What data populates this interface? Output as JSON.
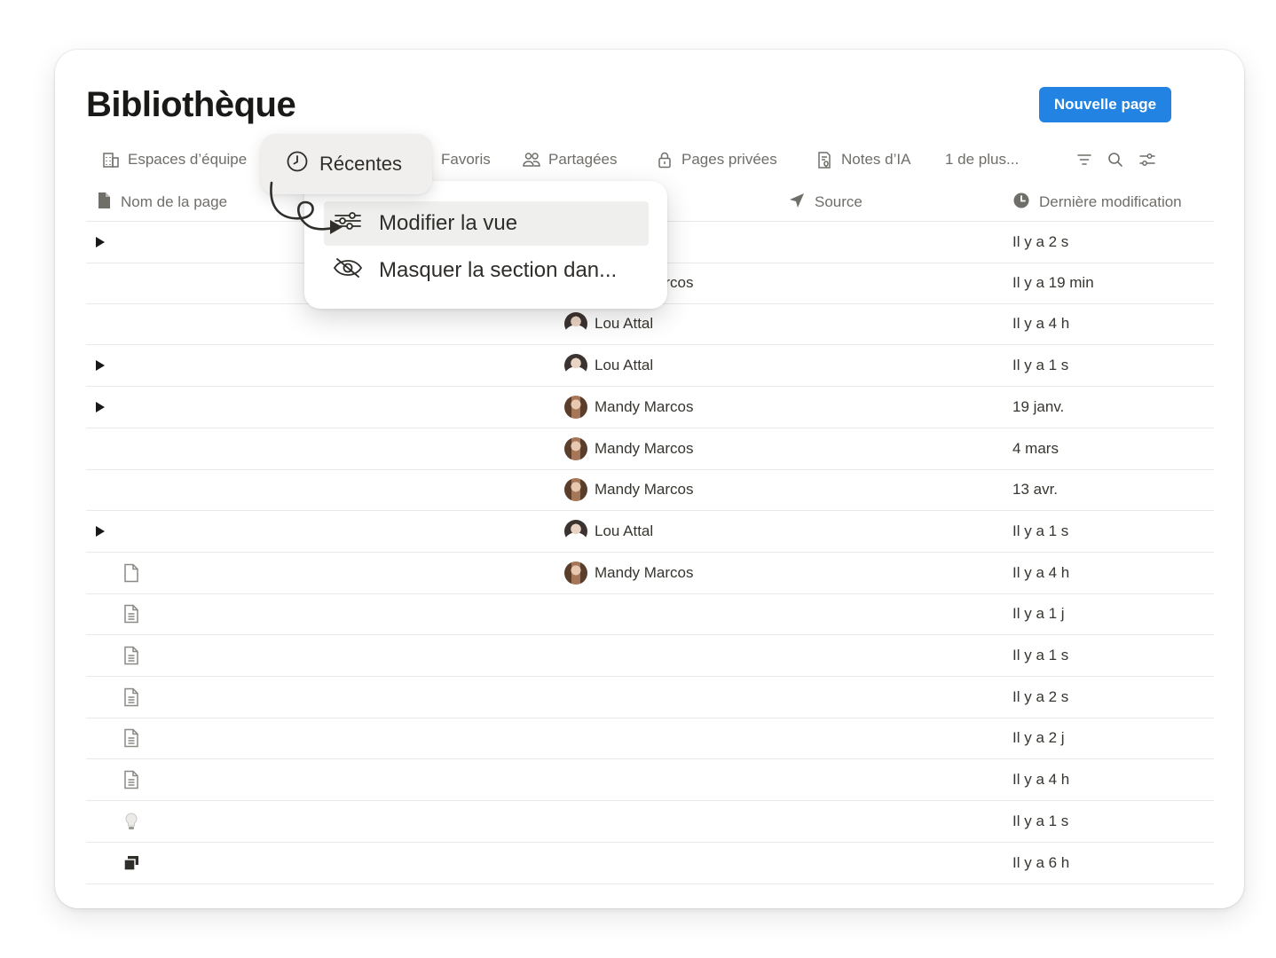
{
  "page": {
    "title": "Bibliothèque",
    "new_page_label": "Nouvelle page"
  },
  "tabs": [
    {
      "label": "Espaces d’équipe",
      "icon": "building-icon"
    },
    {
      "label": "Récentes",
      "icon": "clock-icon"
    },
    {
      "label": "Favoris",
      "icon": "star-icon"
    },
    {
      "label": "Partagées",
      "icon": "people-icon"
    },
    {
      "label": "Pages privées",
      "icon": "lock-icon"
    },
    {
      "label": "Notes d’IA",
      "icon": "ai-notes-icon"
    },
    {
      "label": "1 de plus..."
    }
  ],
  "toolbar": {
    "icons": [
      "filter-icon",
      "search-icon",
      "settings-sliders-icon"
    ]
  },
  "columns": {
    "name": "Nom de la page",
    "source": "Source",
    "modified": "Dernière modification"
  },
  "rows": [
    {
      "toggle": true,
      "icon": "",
      "source": "",
      "avatar": "",
      "modified": "Il y a 2 s"
    },
    {
      "toggle": false,
      "icon": "",
      "source": "Mandy Marcos",
      "avatar": "mandy",
      "modified": "Il y a 19 min"
    },
    {
      "toggle": false,
      "icon": "",
      "source": "Lou Attal",
      "avatar": "lou",
      "modified": "Il y a 4 h"
    },
    {
      "toggle": true,
      "icon": "",
      "source": "Lou Attal",
      "avatar": "lou",
      "modified": "Il y a 1 s"
    },
    {
      "toggle": true,
      "icon": "",
      "source": "Mandy Marcos",
      "avatar": "mandy",
      "modified": "19 janv."
    },
    {
      "toggle": false,
      "icon": "",
      "source": "Mandy Marcos",
      "avatar": "mandy",
      "modified": "4 mars"
    },
    {
      "toggle": false,
      "icon": "",
      "source": "Mandy Marcos",
      "avatar": "mandy",
      "modified": "13 avr."
    },
    {
      "toggle": true,
      "icon": "",
      "source": "Lou Attal",
      "avatar": "lou",
      "modified": "Il y a 1 s"
    },
    {
      "toggle": false,
      "icon": "page-icon",
      "source": "Mandy Marcos",
      "avatar": "mandy",
      "modified": "Il y a 4 h"
    },
    {
      "toggle": false,
      "icon": "document-icon",
      "source": "",
      "avatar": "",
      "modified": "Il y a 1 j"
    },
    {
      "toggle": false,
      "icon": "document-icon",
      "source": "",
      "avatar": "",
      "modified": "Il y a 1 s"
    },
    {
      "toggle": false,
      "icon": "document-icon",
      "source": "",
      "avatar": "",
      "modified": "Il y a 2 s"
    },
    {
      "toggle": false,
      "icon": "document-icon",
      "source": "",
      "avatar": "",
      "modified": "Il y a 2 j"
    },
    {
      "toggle": false,
      "icon": "document-icon",
      "source": "",
      "avatar": "",
      "modified": "Il y a 4 h"
    },
    {
      "toggle": false,
      "icon": "lightbulb-icon",
      "source": "",
      "avatar": "",
      "modified": "Il y a 1 s"
    },
    {
      "toggle": false,
      "icon": "stacked-pages-icon",
      "source": "",
      "avatar": "",
      "modified": "Il y a 6 h"
    }
  ],
  "popup": {
    "active_tab": "Récentes",
    "items": [
      {
        "label": "Modifier la vue",
        "icon": "sliders-icon"
      },
      {
        "label": "Masquer la section dan...",
        "icon": "eye-off-icon"
      }
    ]
  },
  "colors": {
    "accent": "#2383e2",
    "text": "#37352f",
    "muted": "#6f6e69",
    "divider": "#e9e9e7"
  }
}
